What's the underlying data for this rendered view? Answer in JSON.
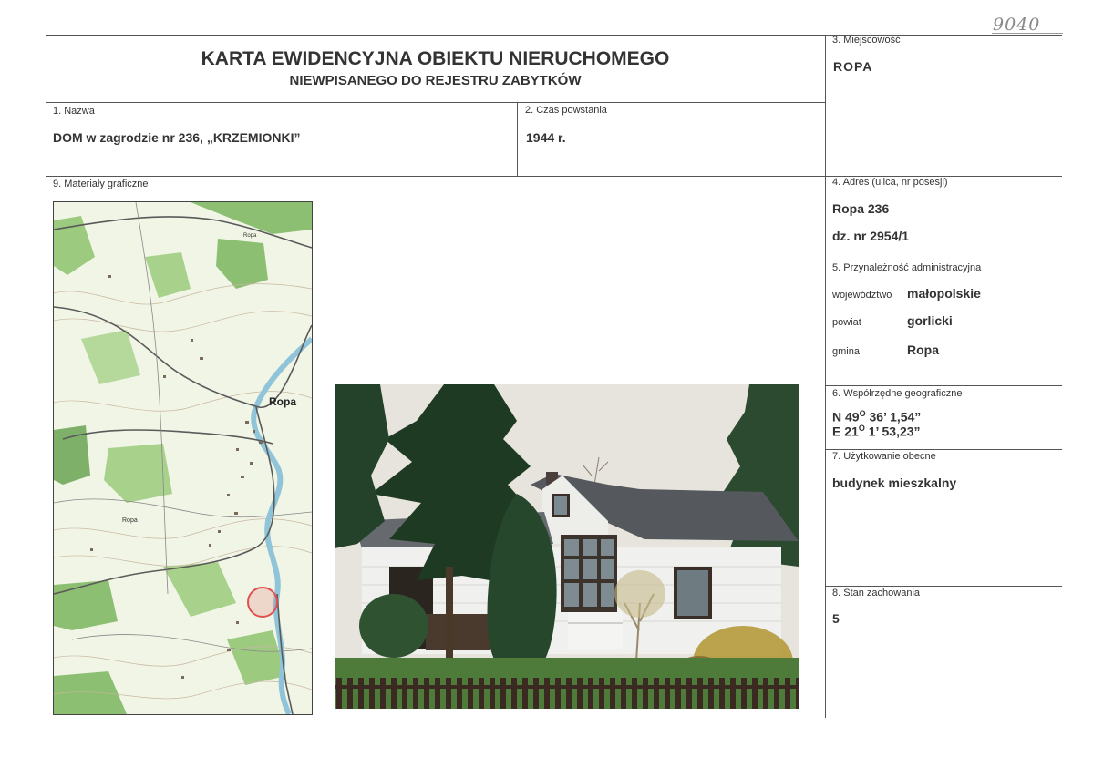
{
  "header": {
    "handwritten_number": "9040",
    "title_line1": "KARTA EWIDENCYJNA OBIEKTU NIERUCHOMEGO",
    "title_line2": "NIEWPISANEGO DO REJESTRU ZABYTKÓW"
  },
  "fields": {
    "miejscowosc": {
      "label": "3. Miejscowość",
      "value": "ROPA"
    },
    "nazwa": {
      "label": "1. Nazwa",
      "value": "DOM w zagrodzie nr 236, „KRZEMIONKI”"
    },
    "czas_powstania": {
      "label": "2. Czas powstania",
      "value": "1944 r."
    },
    "materialy": {
      "label": "9. Materiały graficzne"
    },
    "adres": {
      "label": "4. Adres (ulica, nr posesji)",
      "line1": "Ropa 236",
      "line2": "dz. nr 2954/1"
    },
    "przynaleznosc": {
      "label": "5. Przynależność administracyjna",
      "wojewodztwo_label": "województwo",
      "wojewodztwo_value": "małopolskie",
      "powiat_label": "powiat",
      "powiat_value": "gorlicki",
      "gmina_label": "gmina",
      "gmina_value": "Ropa"
    },
    "wspolrzedne": {
      "label": "6. Współrzędne geograficzne",
      "n_prefix": "N 49",
      "n_deg": "O",
      "n_rest": " 36’ 1,54”",
      "e_prefix": "E 21",
      "e_deg": "O",
      "e_rest": " 1’ 53,23”"
    },
    "uzytkowanie": {
      "label": "7. Użytkowanie obecne",
      "value": "budynek mieszkalny"
    },
    "stan": {
      "label": "8. Stan zachowania",
      "value": "5"
    }
  },
  "map": {
    "place_label": "Ropa",
    "small_labels": [
      "Ropa",
      "Ropa"
    ]
  },
  "colors": {
    "map_green": "#7fb069",
    "map_river": "#8fc4d9",
    "map_road": "#555555",
    "marker": "#e05050",
    "sky": "#e6e4dc",
    "tree": "#1f3a22",
    "roof": "#55585c",
    "wall": "#f2f2f0"
  }
}
